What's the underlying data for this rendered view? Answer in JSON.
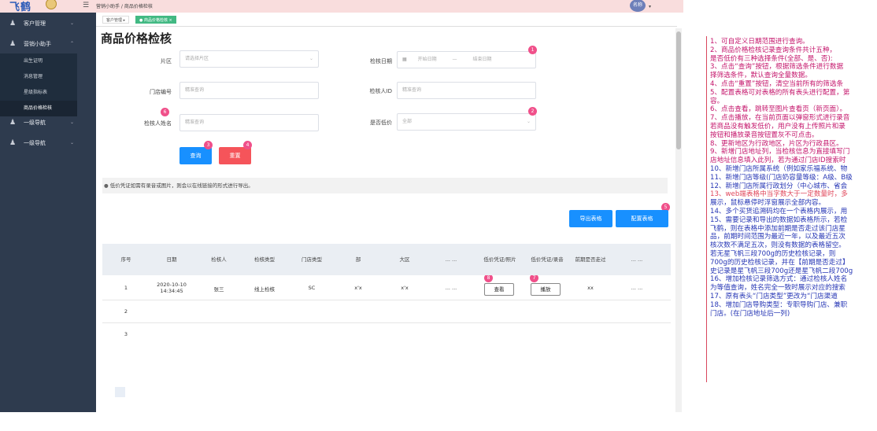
{
  "header": {
    "logo_text": "飞鹤",
    "breadcrumb": "营销小助手 / 商品价格检核",
    "avatar_text": "名称"
  },
  "tags": {
    "home": "客户管理",
    "current": "商品价格检核"
  },
  "sidebar": {
    "groups": [
      {
        "label": "客户管理"
      },
      {
        "label": "营销小助手"
      },
      {
        "label": "一级导航"
      },
      {
        "label": "一级导航"
      }
    ],
    "subitems": [
      {
        "label": "出生证明"
      },
      {
        "label": "消息管理"
      },
      {
        "label": "星级指标表"
      },
      {
        "label": "商品价格检核"
      }
    ]
  },
  "page": {
    "title": "商品价格检核",
    "form": {
      "region_label": "片区",
      "region_placeholder": "请选择片区",
      "date_label": "检核日期",
      "date_start": "开始日期",
      "date_sep": "—",
      "date_end": "结束日期",
      "store_label": "门店编号",
      "store_placeholder": "精准查询",
      "checker_id_label": "检核人ID",
      "checker_id_placeholder": "精准查询",
      "checker_name_label": "检核人姓名",
      "checker_name_placeholder": "精准查询",
      "low_price_label": "是否低价",
      "low_price_value": "全部",
      "query_button": "查询",
      "reset_button": "重置"
    },
    "notice": "低价凭证如需有录音或图片，则会以在线链接的形式进行导出。",
    "export_button": "导出表格",
    "config_button": "配置表格",
    "markers": [
      "1",
      "2",
      "3",
      "4",
      "5",
      "6",
      "7",
      "8"
    ],
    "table": {
      "headers": [
        "序号",
        "日期",
        "检核人",
        "检核类型",
        "门店类型",
        "部",
        "大区",
        "... ...",
        "低价凭证/照片",
        "低价凭证/录音",
        "前期是否走过",
        "... ..."
      ],
      "rows": [
        {
          "index": "1",
          "date": "2020-10-10 14:34:45",
          "checker": "张三",
          "type": "线上检核",
          "store_type": "SC",
          "dept": "x'x",
          "region": "x'x",
          "more": "... ...",
          "photo_btn": "查看",
          "audio_btn": "播放",
          "previous": "xx",
          "more2": "... ..."
        },
        {
          "index": "2"
        },
        {
          "index": "3"
        }
      ]
    }
  },
  "notes": [
    "1、可自定义日期范围进行查询。",
    "2、商品价格检核记录查询条件共计五种，",
    "    是否低价有三种选择条件(全部、是、否):",
    "3、点击“查询”按钮，根据筛选条件进行数据",
    "择筛选条件，默认查询全量数据。",
    "4、点击“重置”按钮，清空当前所有的筛选条",
    "5、配置表格可对表格的所有表头进行配置，第",
    "容。",
    "6、点击查看，跳转至图片查看页（新页面）。",
    "7、点击播放，在当前页面以弹窗形式进行录音",
    "若商品没有触发低价，用户没有上传照片和录",
    "按钮和播放录音按钮置灰不可点击。",
    "8、更新地区为行政地区，片区为行政县区。",
    "9、新增门店地址列，当检核信息为直接填写门",
    "店地址信息填入此列，若为通过门店ID搜索时",
    "10、新增门店所属系统（例如家乐福系统、物",
    "11、新增门店等级(门店奶容量等级：A级、B级",
    "12、新增门店所属行政划分（中心城市、省会",
    "13、web端表格中当字数大于一定数量时，多",
    "展示，鼠标悬停时浮窗展示全部内容。",
    "14、多个买货追溯码均在一个表格内展示，用",
    "15、需要记录和导出的数据如表格所示，若检",
    "飞鹤，则在表格中添加前期是否走过该门店星",
    "品，前期时间范围为最近一年，以及最近五次",
    "核次数不满足五次，则没有数据的表格留空。",
    "      若无星飞帆三段700g的历史检核记录，则",
    "700g的历史检核记录，并在【前期是否走过】",
    "史记录是星飞帆三段700g还是星飞帆二段700g",
    "16、增加检核记录筛选方式：通过检核人姓名",
    "为等值查询，姓名完全一致时展示对应的搜索",
    "17、原有表头“门店类型”更改为“门店渠道",
    "18、增加门店导购类型：专职导购门店、兼职",
    "门店。(在门店地址后一列)"
  ],
  "colors": {
    "sidebar": "#2e3b4e",
    "primary": "#1890ff",
    "danger": "#f5545a",
    "marker": "#f0508a",
    "note_red": "#c4156b",
    "note_blue": "#2636b5"
  }
}
